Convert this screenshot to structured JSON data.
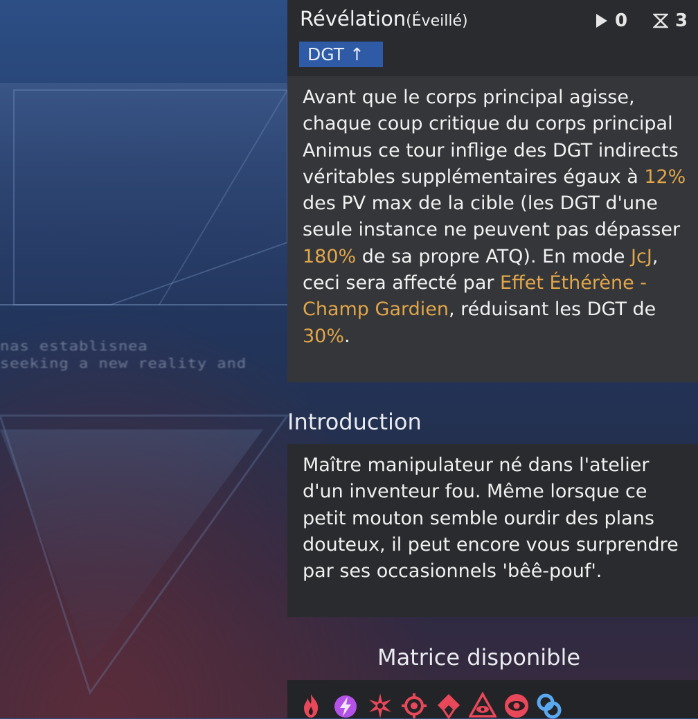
{
  "background": {
    "text_line_1": "nas establisnea",
    "text_line_2": "seeking a new reality and"
  },
  "skill": {
    "title": "Révélation",
    "suffix": "(Éveillé)",
    "tag": "DGT ↑",
    "stats": {
      "uses_value": "0",
      "cooldown_value": "3"
    },
    "description": [
      {
        "text": "Avant que le corps principal agisse, chaque coup critique du corps principal Animus ce tour inflige des DGT indirects véritables supplémentaires égaux à ",
        "hl": false
      },
      {
        "text": "12%",
        "hl": true
      },
      {
        "text": " des PV max de la cible (les DGT d'une seule instance ne peuvent pas dépasser ",
        "hl": false
      },
      {
        "text": "180%",
        "hl": true
      },
      {
        "text": " de sa propre ATQ). En mode ",
        "hl": false
      },
      {
        "text": "JcJ",
        "hl": true
      },
      {
        "text": ", ceci sera affecté par ",
        "hl": false
      },
      {
        "text": "Effet Éthérène - Champ Gardien",
        "hl": true
      },
      {
        "text": ", réduisant les DGT de ",
        "hl": false
      },
      {
        "text": "30%",
        "hl": true
      },
      {
        "text": ".",
        "hl": false
      }
    ]
  },
  "introduction": {
    "heading": "Introduction",
    "text": "Maître manipulateur né dans l'atelier d'un inventeur fou. Même lorsque ce petit mouton semble ourdir des plans douteux, il peut encore vous surprendre par ses occasionnels 'bêê-pouf'."
  },
  "matrix": {
    "heading": "Matrice disponible",
    "icons": [
      {
        "name": "flame-matrix-icon",
        "color": "#e8485a"
      },
      {
        "name": "lightning-matrix-icon",
        "color": "#b452e8"
      },
      {
        "name": "burst-matrix-icon",
        "color": "#e8485a"
      },
      {
        "name": "crosshair-matrix-icon",
        "color": "#e8485a"
      },
      {
        "name": "arrow-matrix-icon",
        "color": "#e8485a"
      },
      {
        "name": "eye-pyramid-matrix-icon",
        "color": "#e8485a"
      },
      {
        "name": "eye-orb-matrix-icon",
        "color": "#e8485a"
      },
      {
        "name": "chain-link-matrix-icon",
        "color": "#5aa8f0"
      }
    ]
  },
  "colors": {
    "highlight": "#e0a64a",
    "tag_bg": "#2e5aa6",
    "panel_bg": "#35363a"
  }
}
